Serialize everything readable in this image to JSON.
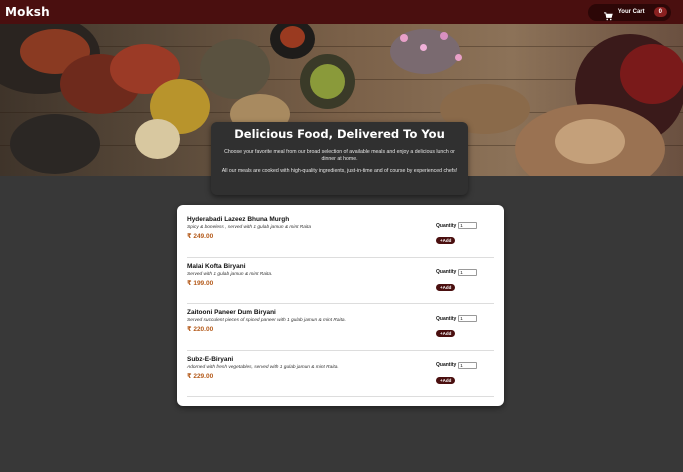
{
  "header": {
    "brand": "Moksh",
    "cart_label": "Your Cart",
    "cart_count": "0",
    "icon": "cart-icon"
  },
  "intro": {
    "title": "Delicious Food, Delivered To You",
    "paragraph1": "Choose your favorite meal from our broad selection of available meals and enjoy a delicious lunch or dinner at home.",
    "paragraph2": "All our meals are cooked with high-quality ingredients, just-in-time and of course by experienced chefs!"
  },
  "meals": [
    {
      "name": "Hyderabadi Lazeez Bhuna Murgh",
      "description": "Spicy & boneless , served with 1 gulab jamun & mint Raita",
      "price": "₹ 249.00",
      "quantity_label": "Quantity",
      "quantity": "1",
      "add_label": "+Add"
    },
    {
      "name": "Malai Kofta Biryani",
      "description": "Served with 1 gulab jamun & mint Raita.",
      "price": "₹ 199.00",
      "quantity_label": "Quantity",
      "quantity": "1",
      "add_label": "+Add"
    },
    {
      "name": "Zaitooni Paneer Dum Biryani",
      "description": "Served succulent pieces of spiced paneer with 1 gulab jamun & mint Raita.",
      "price": "₹ 220.00",
      "quantity_label": "Quantity",
      "quantity": "1",
      "add_label": "+Add"
    },
    {
      "name": "Subz-E-Biryani",
      "description": "Adorned with fresh vegetables, served with 1 gulab jamun & mint Raita.",
      "price": "₹ 229.00",
      "quantity_label": "Quantity",
      "quantity": "1",
      "add_label": "+Add"
    }
  ],
  "colors": {
    "header_bg": "#4a0f0f",
    "page_bg": "#383838",
    "price": "#b45a1a",
    "add_button": "#4a0f0f"
  }
}
